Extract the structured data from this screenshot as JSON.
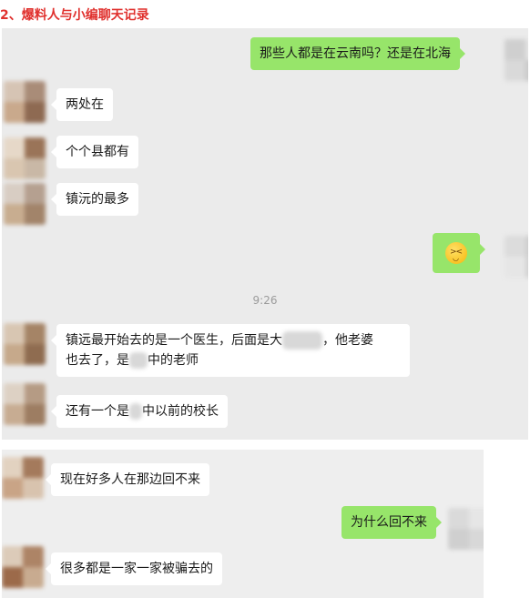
{
  "heading": "2、爆料人与小编聊天记录",
  "colors": {
    "heading": "#e0312e",
    "bubble_self": "#97e56a",
    "bubble_other": "#ffffff",
    "chat_bg": "#ebebeb"
  },
  "chat1": {
    "messages": [
      {
        "side": "right",
        "text": "那些人都是在云南吗？还是在北海"
      },
      {
        "side": "left",
        "text": "两处在"
      },
      {
        "side": "left",
        "text": "个个县都有"
      },
      {
        "side": "left",
        "text": "镇沅的最多"
      },
      {
        "side": "right",
        "emoji": "laughing-emoji-icon"
      }
    ],
    "time": "9:26",
    "after_time": [
      {
        "side": "left",
        "line1_a": "镇远最开始去的是一个医生，后面是大",
        "line1_b": "，他老婆",
        "line2_a": "也去了，是",
        "line2_b": "中的老师"
      },
      {
        "side": "left",
        "text_a": "还有一个是",
        "text_b": "中以前的校长"
      }
    ]
  },
  "chat2": {
    "messages": [
      {
        "side": "left",
        "text": "现在好多人在那边回不来"
      },
      {
        "side": "right",
        "text": "为什么回不来"
      },
      {
        "side": "left",
        "text": "很多都是一家一家被骗去的"
      }
    ]
  }
}
